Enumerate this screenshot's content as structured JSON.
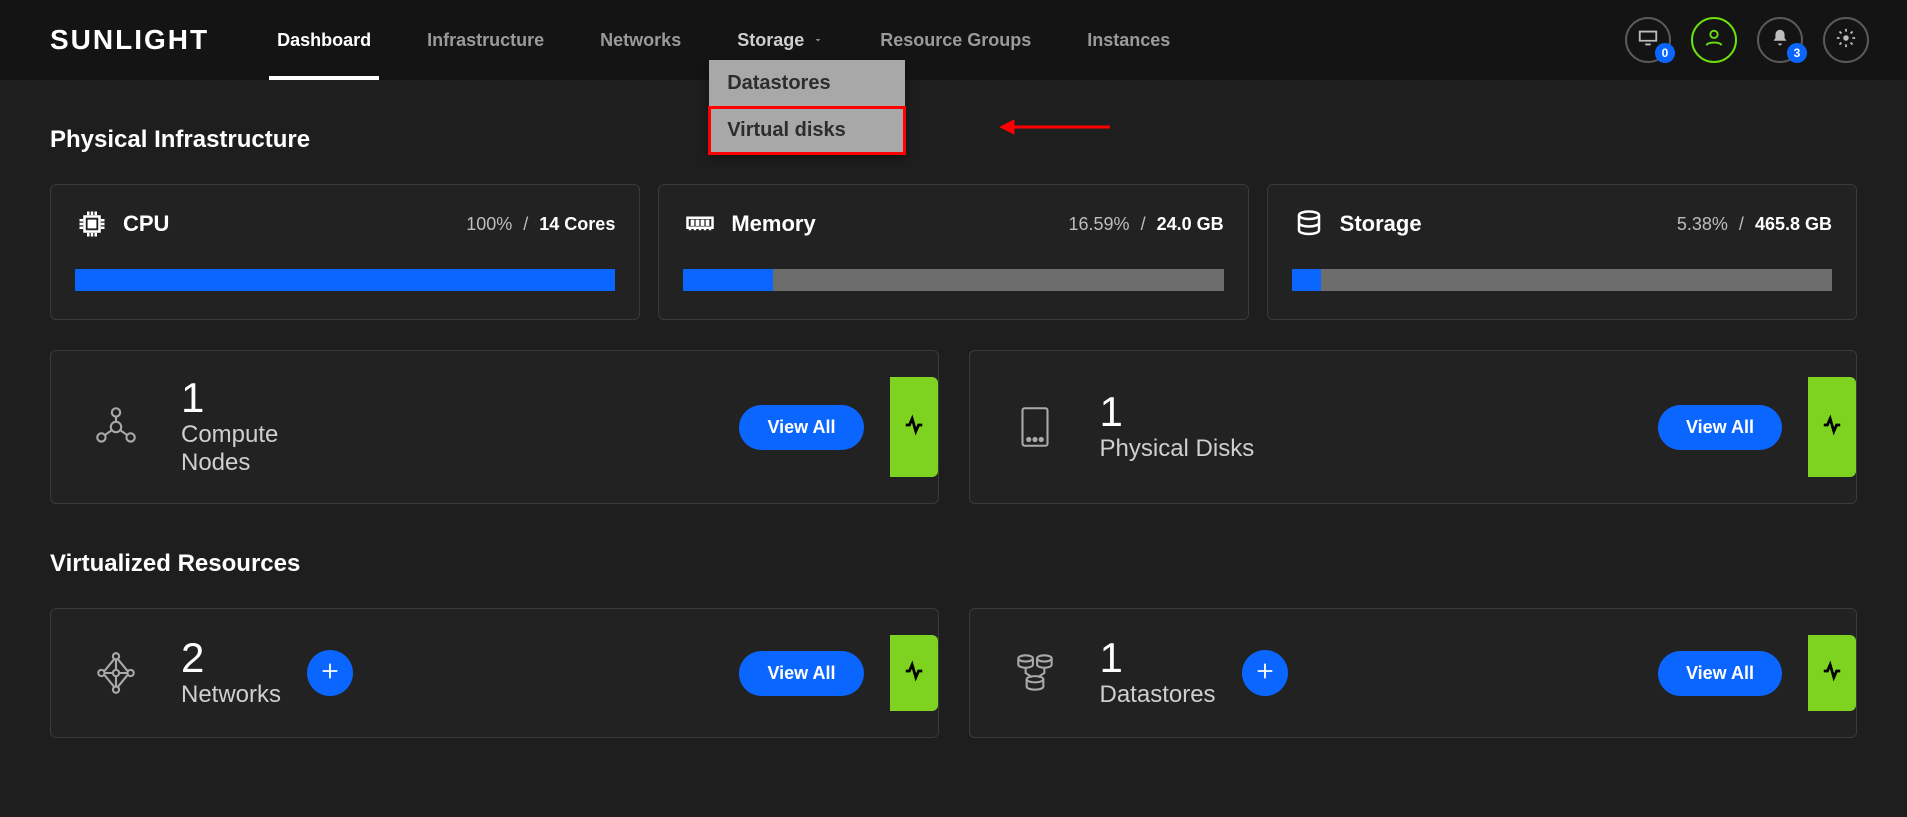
{
  "brand": "SUNLIGHT",
  "nav": {
    "items": [
      {
        "label": "Dashboard"
      },
      {
        "label": "Infrastructure"
      },
      {
        "label": "Networks"
      },
      {
        "label": "Storage"
      },
      {
        "label": "Resource Groups"
      },
      {
        "label": "Instances"
      }
    ],
    "dropdown": {
      "items": [
        {
          "label": "Datastores"
        },
        {
          "label": "Virtual disks"
        }
      ]
    }
  },
  "header_badges": {
    "monitor": "0",
    "bell": "3"
  },
  "sections": {
    "physical_title": "Physical Infrastructure",
    "virtual_title": "Virtualized Resources"
  },
  "stats": {
    "cpu": {
      "title": "CPU",
      "percent_text": "100%",
      "value": "14 Cores",
      "fill_pct": 100
    },
    "memory": {
      "title": "Memory",
      "percent_text": "16.59%",
      "value": "24.0 GB",
      "fill_pct": 16.59
    },
    "storage": {
      "title": "Storage",
      "percent_text": "5.38%",
      "value": "465.8 GB",
      "fill_pct": 5.38
    }
  },
  "resources": {
    "compute": {
      "count": "1",
      "label": "Compute Nodes",
      "view": "View All"
    },
    "disks": {
      "count": "1",
      "label": "Physical Disks",
      "view": "View All"
    },
    "networks": {
      "count": "2",
      "label": "Networks",
      "view": "View All"
    },
    "datastores": {
      "count": "1",
      "label": "Datastores",
      "view": "View All"
    }
  },
  "colors": {
    "accent_blue": "#0b66ff",
    "status_green": "#7ed321",
    "highlight_green": "#6de00f",
    "annotation_red": "#ff0000"
  }
}
